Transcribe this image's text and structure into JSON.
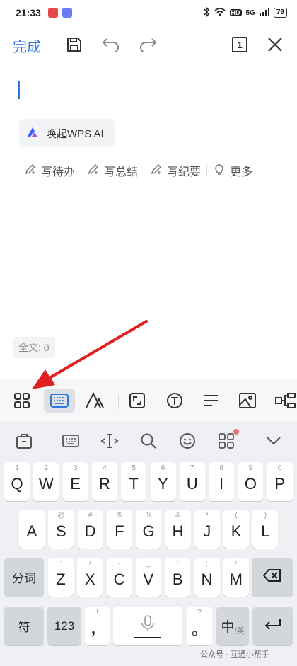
{
  "status_bar": {
    "time": "21:33",
    "network": "5G",
    "battery": "79",
    "hd": "HD"
  },
  "toolbar": {
    "done_label": "完成",
    "page_count": "1"
  },
  "editor": {
    "ai_button_label": "唤起WPS AI",
    "quick_actions": [
      "写待办",
      "写总结",
      "写纪要",
      "更多"
    ],
    "word_count": "全文: 0"
  },
  "keyboard": {
    "row1": [
      {
        "main": "Q",
        "sub": "1"
      },
      {
        "main": "W",
        "sub": "2"
      },
      {
        "main": "E",
        "sub": "3"
      },
      {
        "main": "R",
        "sub": "4"
      },
      {
        "main": "T",
        "sub": "5"
      },
      {
        "main": "Y",
        "sub": "6"
      },
      {
        "main": "U",
        "sub": "7"
      },
      {
        "main": "I",
        "sub": "8"
      },
      {
        "main": "O",
        "sub": "9"
      },
      {
        "main": "P",
        "sub": "0"
      }
    ],
    "row2": [
      {
        "main": "A",
        "sub": "~"
      },
      {
        "main": "S",
        "sub": "@"
      },
      {
        "main": "D",
        "sub": "#"
      },
      {
        "main": "F",
        "sub": "$"
      },
      {
        "main": "G",
        "sub": "%"
      },
      {
        "main": "H",
        "sub": "&"
      },
      {
        "main": "J",
        "sub": "*"
      },
      {
        "main": "K",
        "sub": "("
      },
      {
        "main": "L",
        "sub": ")"
      }
    ],
    "row3": [
      {
        "main": "Z",
        "sub": "'"
      },
      {
        "main": "X",
        "sub": "/"
      },
      {
        "main": "C",
        "sub": "-"
      },
      {
        "main": "V",
        "sub": "_"
      },
      {
        "main": "B",
        "sub": ":"
      },
      {
        "main": "N",
        "sub": ";"
      },
      {
        "main": "M",
        "sub": "!"
      }
    ],
    "segment_key": "分词",
    "symbol_key": "符",
    "number_key": "123",
    "comma_key": "，",
    "comma_sub": "!",
    "period_key": "。",
    "period_sub": "?",
    "lang_key": "中",
    "lang_sub": "/英"
  },
  "watermark": "公众号 · 互通小帮手",
  "colors": {
    "accent": "#2a7ae2",
    "annotation_arrow": "#e02020"
  }
}
